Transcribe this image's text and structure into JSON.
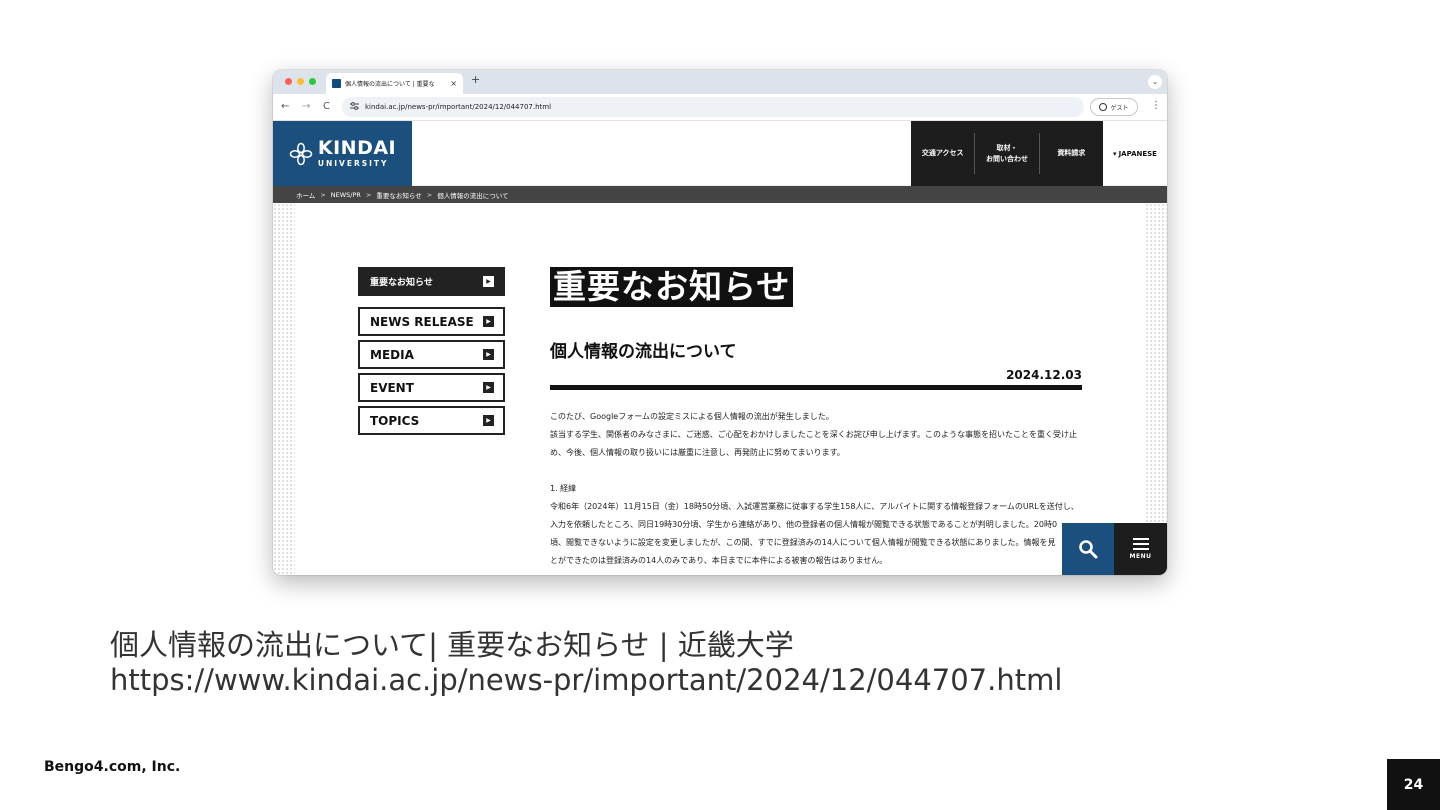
{
  "browser": {
    "tab_title": "個人情報の流出について | 重要な",
    "tab_close": "×",
    "new_tab": "+",
    "tab_menu": "⌄",
    "nav_back": "←",
    "nav_forward": "→",
    "nav_reload": "C",
    "url": "kindai.ac.jp/news-pr/important/2024/12/044707.html",
    "guest_label": "ゲスト",
    "more_menu": "⋮"
  },
  "site": {
    "logo_main": "KINDAI",
    "logo_sub": "UNIVERSITY",
    "header_nav": [
      "交通アクセス",
      "取材・\nお問い合わせ",
      "資料請求"
    ],
    "language": "JAPANESE",
    "breadcrumb": [
      "ホーム",
      "NEWS/PR",
      "重要なお知らせ",
      "個人情報の流出について"
    ],
    "breadcrumb_sep": ">",
    "side_nav": [
      {
        "label": "重要なお知らせ",
        "active": true
      },
      {
        "label": "NEWS RELEASE",
        "active": false
      },
      {
        "label": "MEDIA",
        "active": false
      },
      {
        "label": "EVENT",
        "active": false
      },
      {
        "label": "TOPICS",
        "active": false
      }
    ],
    "section_title": "重要なお知らせ",
    "article_title": "個人情報の流出について",
    "article_date": "2024.12.03",
    "intro_lines": [
      "このたび、Googleフォームの設定ミスによる個人情報の流出が発生しました。",
      "該当する学生、関係者のみなさまに、ご迷惑、ご心配をおかけしましたことを深くお詫び申し上げます。このような事態を招いたことを重く受け止",
      "め、今後、個人情報の取り扱いには厳重に注意し、再発防止に努めてまいります。"
    ],
    "section1_heading": "1. 経緯",
    "section1_lines": [
      "令和6年（2024年）11月15日（金）18時50分頃、入試運営業務に従事する学生158人に、アルバイトに関する情報登録フォームのURLを送付し、",
      "入力を依頼したところ、同日19時30分頃、学生から連絡があり、他の登録者の個人情報が閲覧できる状態であることが判明しました。20時0",
      "頃、閲覧できないように設定を変更しましたが、この間、すでに登録済みの14人について個人情報が閲覧できる状態にありました。情報を見",
      "とができたのは登録済みの14人のみであり、本日までに本件による被害の報告はありません。"
    ],
    "menu_label": "MENU"
  },
  "slide": {
    "caption_title": "個人情報の流出について| 重要なお知らせ | 近畿大学",
    "caption_url": "https://www.kindai.ac.jp/news-pr/important/2024/12/044707.html",
    "company": "Bengo4.com, Inc.",
    "page_number": "24"
  },
  "colors": {
    "kindai_blue": "#1b4f7d",
    "dark": "#1d1d1d",
    "breadcrumb_bg": "#444444"
  }
}
